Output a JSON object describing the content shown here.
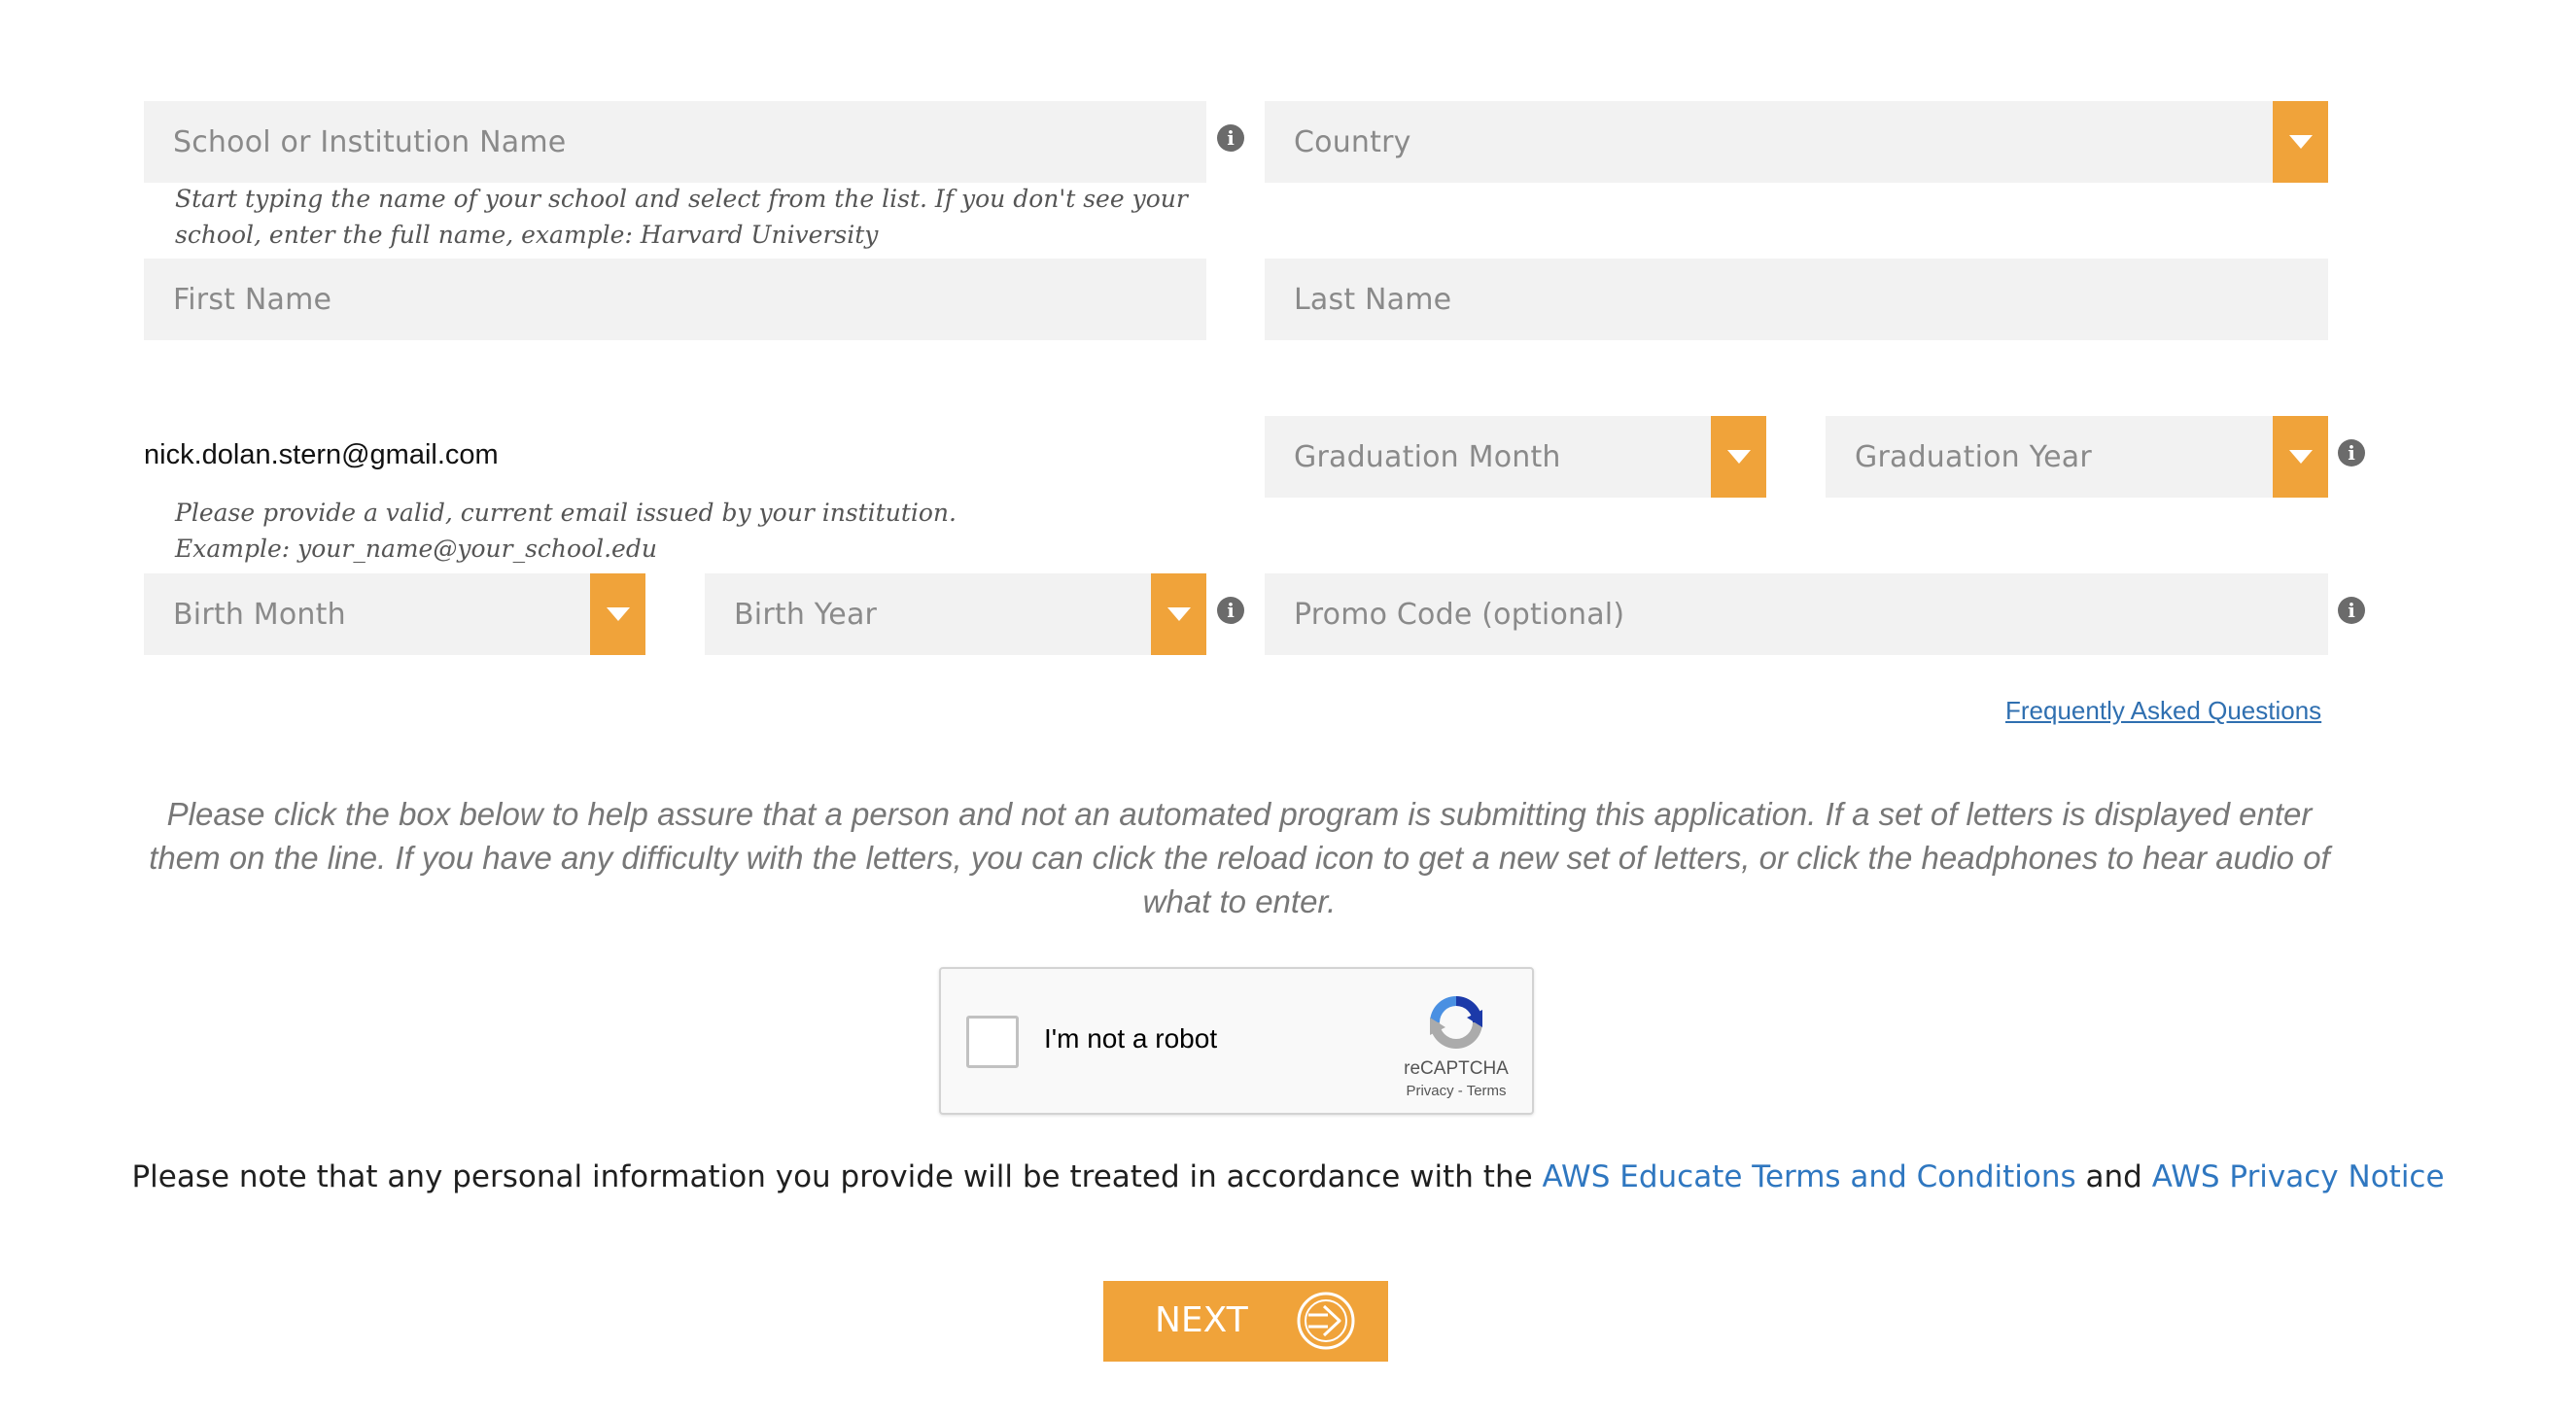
{
  "form": {
    "school": {
      "placeholder": "School or Institution Name",
      "hint": "Start typing the name of your school and select from the list. If you don't see your school, enter the full name, example: Harvard University"
    },
    "country": {
      "placeholder": "Country"
    },
    "first_name": {
      "placeholder": "First Name"
    },
    "last_name": {
      "placeholder": "Last Name"
    },
    "email": {
      "value": "nick.dolan.stern@gmail.com",
      "hint": "Please provide a valid, current email issued by your institution. Example: your_name@your_school.edu"
    },
    "graduation_month": {
      "placeholder": "Graduation Month"
    },
    "graduation_year": {
      "placeholder": "Graduation Year"
    },
    "birth_month": {
      "placeholder": "Birth Month"
    },
    "birth_year": {
      "placeholder": "Birth Year"
    },
    "promo_code": {
      "placeholder": "Promo Code (optional)"
    },
    "info_glyph": "i"
  },
  "faq_link": "Frequently Asked Questions",
  "captcha_instructions": "Please click the box below to help assure that a person and not an automated program is submitting this application. If a set of letters is displayed enter them on the line. If you have any difficulty with the letters, you can click the reload icon to get a new set of letters, or click the headphones to hear audio of what to enter.",
  "recaptcha": {
    "label": "I'm not a robot",
    "brand": "reCAPTCHA",
    "privacy": "Privacy",
    "separator": " - ",
    "terms": "Terms"
  },
  "notice": {
    "prefix": "Please note that any personal information you provide will be treated in accordance with the ",
    "terms_link": "AWS Educate Terms and Conditions",
    "middle": " and ",
    "privacy_link": "AWS Privacy Notice"
  },
  "next_button": {
    "label": "NEXT",
    "icon": "arrow-circle-right-icon"
  },
  "colors": {
    "accent": "#f0a33a",
    "link": "#2f77c0",
    "field_bg": "#f2f2f2"
  }
}
